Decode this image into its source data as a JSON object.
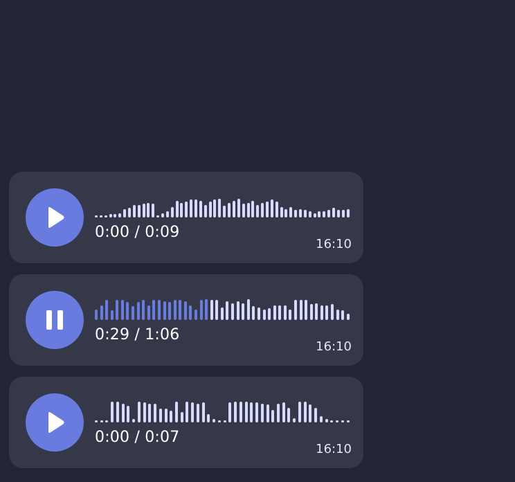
{
  "messages": [
    {
      "state": "paused",
      "button_icon": "play-icon",
      "time_label": "0:00 / 0:09",
      "sent_time": "16:10",
      "progress": 0,
      "waveform": [
        0.1,
        0.1,
        0.1,
        0.15,
        0.15,
        0.2,
        0.4,
        0.45,
        0.6,
        0.6,
        0.65,
        0.7,
        0.65,
        0.1,
        0.2,
        0.3,
        0.5,
        0.8,
        0.7,
        0.75,
        0.85,
        0.85,
        0.8,
        0.6,
        0.75,
        0.85,
        0.9,
        0.55,
        0.7,
        0.8,
        0.9,
        0.65,
        0.7,
        0.8,
        0.6,
        0.7,
        0.75,
        0.85,
        0.75,
        0.5,
        0.4,
        0.5,
        0.35,
        0.4,
        0.35,
        0.3,
        0.2,
        0.3,
        0.3,
        0.35,
        0.45,
        0.35,
        0.35,
        0.4
      ]
    },
    {
      "state": "playing",
      "button_icon": "pause-icon",
      "time_label": "0:29 / 1:06",
      "sent_time": "16:10",
      "progress": 0.44,
      "waveform": [
        0.5,
        0.7,
        0.95,
        0.45,
        0.95,
        0.95,
        0.85,
        0.65,
        0.85,
        0.95,
        0.7,
        0.95,
        0.95,
        0.9,
        0.85,
        0.95,
        0.95,
        0.9,
        0.7,
        0.5,
        0.95,
        1,
        0.95,
        0.95,
        0.6,
        0.9,
        0.8,
        0.9,
        0.8,
        1,
        0.65,
        0.6,
        0.5,
        0.55,
        0.7,
        0.7,
        0.7,
        0.5,
        0.95,
        0.95,
        0.95,
        0.75,
        0.8,
        0.7,
        0.7,
        0.75,
        0.5,
        0.45,
        0.3
      ]
    },
    {
      "state": "paused",
      "button_icon": "play-icon",
      "time_label": "0:00 / 0:07",
      "sent_time": "16:10",
      "progress": 0,
      "waveform": [
        0.1,
        0.1,
        0.1,
        1,
        1,
        0.9,
        0.8,
        0.15,
        1,
        0.95,
        0.9,
        0.9,
        0.65,
        0.65,
        0.55,
        1,
        0.5,
        1,
        0.95,
        0.9,
        0.95,
        0.4,
        0.15,
        0.1,
        0.1,
        0.95,
        1,
        1,
        1,
        0.95,
        0.95,
        0.9,
        0.85,
        0.6,
        0.9,
        0.95,
        0.7,
        0.2,
        1,
        1,
        0.85,
        0.7,
        0.3,
        0.15,
        0.1,
        0.1,
        0.1,
        0.1
      ]
    }
  ]
}
